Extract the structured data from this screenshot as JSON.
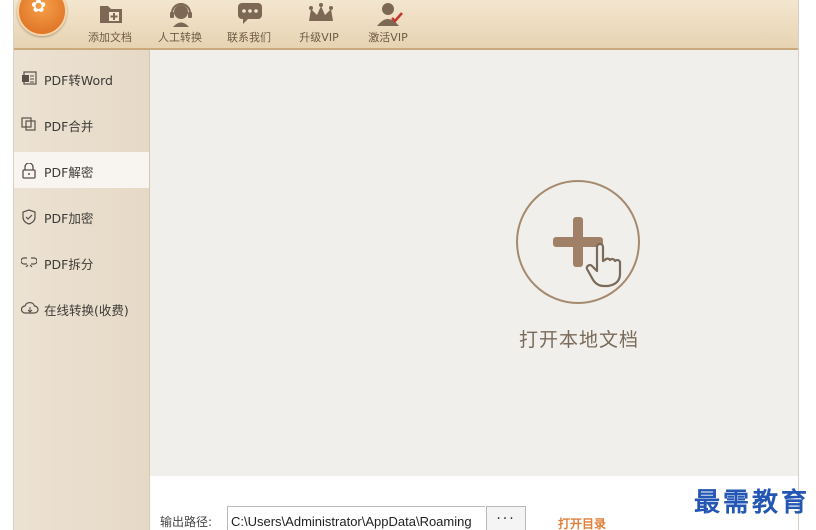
{
  "toolbar": {
    "items": [
      {
        "label": "添加文档",
        "icon": "folder-add-icon"
      },
      {
        "label": "人工转换",
        "icon": "headset-agent-icon"
      },
      {
        "label": "联系我们",
        "icon": "chat-bubble-icon"
      },
      {
        "label": "升级VIP",
        "icon": "crown-icon"
      },
      {
        "label": "激活VIP",
        "icon": "user-check-icon"
      }
    ]
  },
  "sidebar": {
    "items": [
      {
        "label": "PDF转Word",
        "icon": "word-doc-icon"
      },
      {
        "label": "PDF合并",
        "icon": "merge-icon"
      },
      {
        "label": "PDF解密",
        "icon": "unlock-icon",
        "active": true
      },
      {
        "label": "PDF加密",
        "icon": "shield-icon"
      },
      {
        "label": "PDF拆分",
        "icon": "split-icon"
      },
      {
        "label": "在线转换(收费)",
        "icon": "cloud-icon"
      }
    ]
  },
  "main": {
    "open_label": "打开本地文档"
  },
  "bottom": {
    "output_label": "输出路径:",
    "output_path": "C:\\Users\\Administrator\\AppData\\Roaming",
    "browse_label": "···",
    "open_dir_label": "打开目录"
  },
  "watermark": "最需教育",
  "colors": {
    "accent": "#e0803a",
    "toolbar_bg": "#ead9bd",
    "sidebar_bg": "#e9dfd0",
    "active_item": "#f8f5f0",
    "icon_brown": "#8b6f55"
  }
}
